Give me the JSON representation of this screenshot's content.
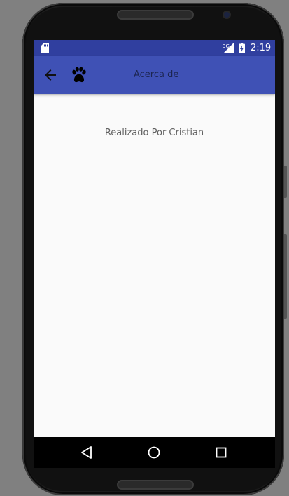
{
  "status_bar": {
    "time": "2:19",
    "network_label": "3G",
    "background": "#303f9f"
  },
  "toolbar": {
    "title": "Acerca de",
    "background": "#3f51b5",
    "back_icon": "arrow-back-icon",
    "logo_icon": "paw-icon"
  },
  "content": {
    "text": "Realizado Por Cristian"
  },
  "navigation": {
    "back_icon": "triangle-back-icon",
    "home_icon": "circle-home-icon",
    "recents_icon": "square-recents-icon"
  }
}
